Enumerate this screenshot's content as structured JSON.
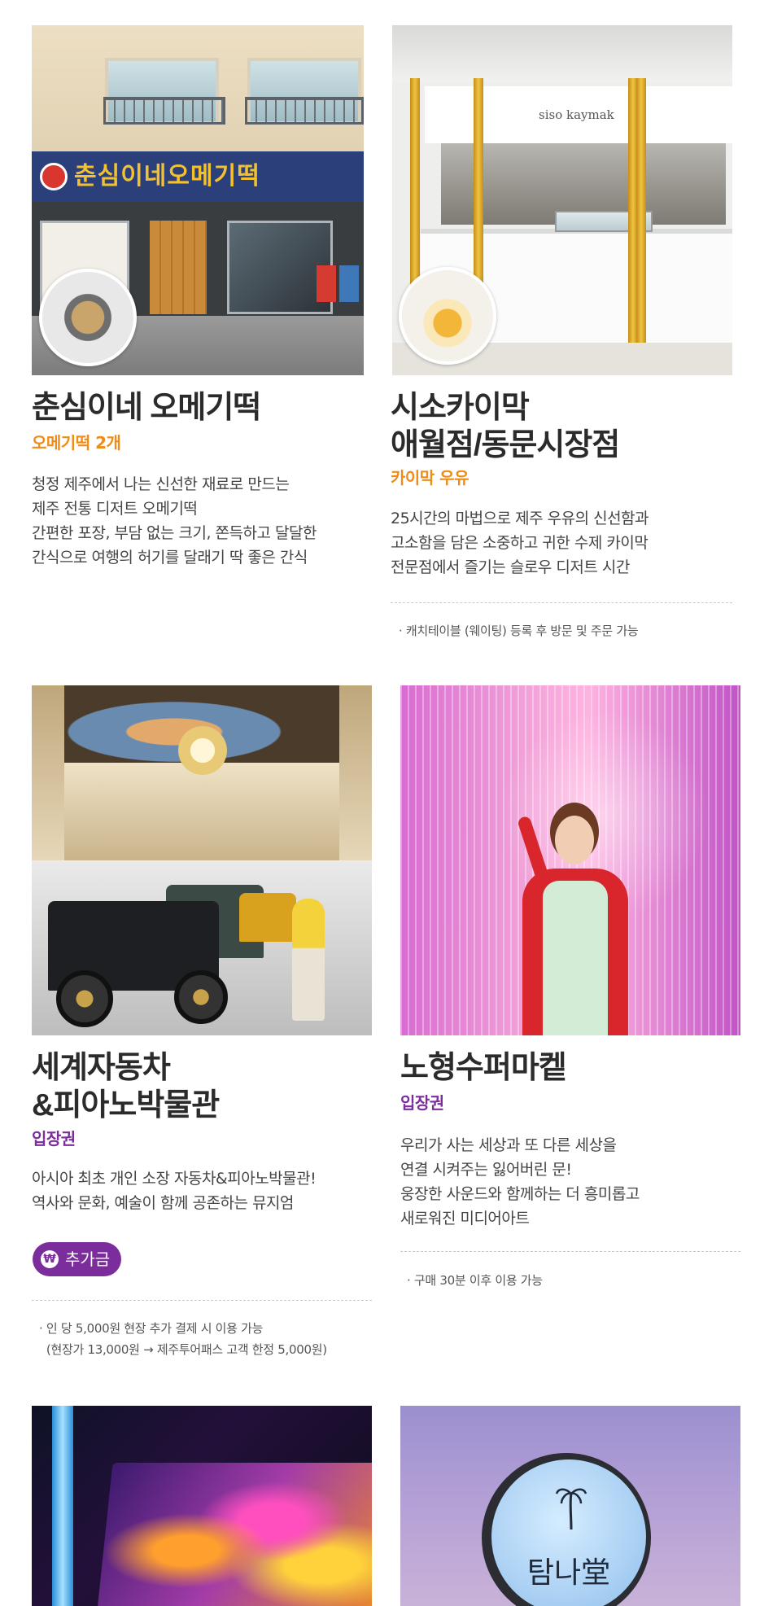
{
  "cards": [
    {
      "title_lines": [
        "춘심이네 오메기떡"
      ],
      "subtitle": "오메기떡 2개",
      "description": [
        "청정 제주에서 나는 신선한 재료로 만드는",
        "제주 전통 디저트 오메기떡",
        "간편한 포장, 부담 없는 크기, 쫀득하고 달달한",
        "간식으로 여행의 허기를 달래기 딱 좋은 간식"
      ],
      "photo_sign": "춘심이네오메기떡"
    },
    {
      "title_lines": [
        "시소카이막",
        "애월점/동문시장점"
      ],
      "subtitle": "카이막 우유",
      "description": [
        "25시간의 마법으로 제주 우유의 신선함과",
        "고소함을 담은 소중하고 귀한 수제 카이막",
        "전문점에서 즐기는 슬로우 디저트 시간"
      ],
      "note": [
        "· 캐치테이블 (웨이팅) 등록 후 방문 및 주문 가능"
      ],
      "photo_sign": "siso kaymak"
    },
    {
      "title_lines": [
        "세계자동차",
        "&피아노박물관"
      ],
      "subtitle": "입장권",
      "description": [
        "아시아 최초 개인 소장 자동차&피아노박물관!",
        "역사와 문화, 예술이 함께 공존하는 뮤지엄"
      ],
      "badge": "추가금",
      "note": [
        "· 인 당 5,000원 현장 추가 결제 시 이용 가능",
        "  (현장가 13,000원 → 제주투어패스 고객 한정 5,000원)"
      ]
    },
    {
      "title_lines": [
        "노형수퍼마켙"
      ],
      "subtitle": "입장권",
      "description": [
        "우리가 사는 세상과 또 다른 세상을",
        "연결 시켜주는 잃어버린 문!",
        "웅장한 사운드와 함께하는 더 흥미롭고",
        "새로워진 미디어아트"
      ],
      "note": [
        "· 구매 30분 이후 이용 가능"
      ]
    },
    {
      "photo_sign": "탐나堂"
    }
  ],
  "colors": {
    "orange": "#ee8c16",
    "purple": "#7b2d9c"
  },
  "icons": {
    "badge_icon": "won-coin-icon"
  }
}
